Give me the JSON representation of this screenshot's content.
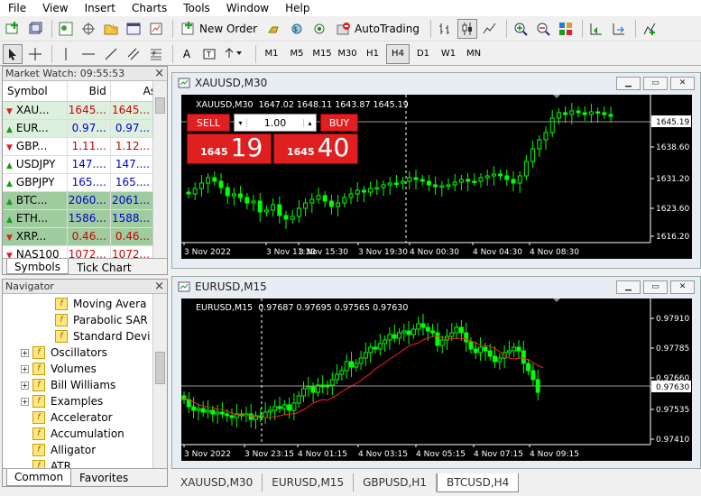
{
  "menu": [
    "File",
    "View",
    "Insert",
    "Charts",
    "Tools",
    "Window",
    "Help"
  ],
  "toolbar": {
    "new_order": "New Order",
    "autotrading": "AutoTrading",
    "timeframes": [
      "M1",
      "M5",
      "M15",
      "M30",
      "H1",
      "H4",
      "D1",
      "W1",
      "MN"
    ],
    "active_timeframe": "H4"
  },
  "market_watch": {
    "title": "Market Watch: 09:55:53",
    "headers": [
      "Symbol",
      "Bid",
      "Ask"
    ],
    "rows": [
      {
        "symbol": "XAU...",
        "bid": "1645...",
        "ask": "1645...",
        "dir": "down",
        "bg": "#ddf0dd",
        "color": "#cc0000"
      },
      {
        "symbol": "EUR...",
        "bid": "0.97...",
        "ask": "0.97...",
        "dir": "up",
        "bg": "#ddf0dd",
        "color": "#0000cc"
      },
      {
        "symbol": "GBP...",
        "bid": "1.11...",
        "ask": "1.12...",
        "dir": "down",
        "bg": "#ffffff",
        "color": "#cc0000"
      },
      {
        "symbol": "USDJPY",
        "bid": "147....",
        "ask": "147....",
        "dir": "up",
        "bg": "#ffffff",
        "color": "#0000cc"
      },
      {
        "symbol": "GBPJPY",
        "bid": "165....",
        "ask": "165....",
        "dir": "up",
        "bg": "#ffffff",
        "color": "#0000cc"
      },
      {
        "symbol": "BTC...",
        "bid": "2060...",
        "ask": "2061...",
        "dir": "up",
        "bg": "#9fcc9f",
        "color": "#0000cc"
      },
      {
        "symbol": "ETH...",
        "bid": "1586...",
        "ask": "1588...",
        "dir": "up",
        "bg": "#9fcc9f",
        "color": "#0000cc"
      },
      {
        "symbol": "XRP...",
        "bid": "0.46...",
        "ask": "0.46...",
        "dir": "down",
        "bg": "#9fcc9f",
        "color": "#cc0000"
      },
      {
        "symbol": "NAS100",
        "bid": "1072...",
        "ask": "1072...",
        "dir": "down",
        "bg": "#ffffff",
        "color": "#cc0000"
      }
    ],
    "tabs": [
      "Symbols",
      "Tick Chart"
    ],
    "active_tab": "Symbols"
  },
  "navigator": {
    "title": "Navigator",
    "items": [
      {
        "label": "Moving Avera",
        "level": 2,
        "expand": false
      },
      {
        "label": "Parabolic SAR",
        "level": 2,
        "expand": false
      },
      {
        "label": "Standard Devi",
        "level": 2,
        "expand": false
      },
      {
        "label": "Oscillators",
        "level": 1,
        "expand": true
      },
      {
        "label": "Volumes",
        "level": 1,
        "expand": true
      },
      {
        "label": "Bill Williams",
        "level": 1,
        "expand": true
      },
      {
        "label": "Examples",
        "level": 1,
        "expand": true
      },
      {
        "label": "Accelerator",
        "level": 1,
        "expand": false
      },
      {
        "label": "Accumulation",
        "level": 1,
        "expand": false
      },
      {
        "label": "Alligator",
        "level": 1,
        "expand": false
      },
      {
        "label": "ATR",
        "level": 1,
        "expand": false
      }
    ],
    "tabs": [
      "Common",
      "Favorites"
    ],
    "active_tab": "Common"
  },
  "chart1": {
    "window_title": "XAUUSD,M30",
    "info": "XAUUSD,M30  1647.02 1648.11 1643.87 1645.19",
    "trade": {
      "sell_label": "SELL",
      "buy_label": "BUY",
      "volume": "1.00",
      "sell_small": "1645",
      "sell_big": "19",
      "buy_small": "1645",
      "buy_big": "40"
    },
    "price_labels": [
      "1645.19",
      "1638.60",
      "1631.20",
      "1623.60",
      "1616.20"
    ],
    "time_labels": [
      "3 Nov 2022",
      "3 Nov 11:30",
      "3 Nov 15:30",
      "3 Nov 19:30",
      "4 Nov 00:30",
      "4 Nov 04:30",
      "4 Nov 08:30"
    ],
    "candle_color": "#00ff00",
    "current_price": "1645.19"
  },
  "chart2": {
    "window_title": "EURUSD,M15",
    "info": "EURUSD,M15  0.97687 0.97695 0.97565 0.97630",
    "price_labels": [
      "0.97910",
      "0.97785",
      "0.97660",
      "0.97630",
      "0.97535",
      "0.97410"
    ],
    "time_labels": [
      "3 Nov 2022",
      "3 Nov 23:15",
      "4 Nov 01:15",
      "4 Nov 03:15",
      "4 Nov 05:15",
      "4 Nov 07:15",
      "4 Nov 09:15"
    ],
    "ma_color": "#ff2020",
    "current_price": "0.97630"
  },
  "bottom_tabs": [
    "XAUUSD,M30",
    "EURUSD,M15",
    "GBPUSD,H1",
    "BTCUSD,H4"
  ],
  "active_bottom_tab": "BTCUSD,H4",
  "colors": {
    "bull": "#00ff00",
    "sell_button": "#e02020",
    "chart_bg": "#000000"
  }
}
